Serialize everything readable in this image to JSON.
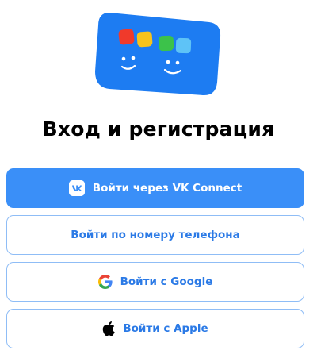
{
  "title": "Вход и регистрация",
  "buttons": {
    "vk": {
      "label": "Войти через VK Connect",
      "icon": "vk-icon"
    },
    "phone": {
      "label": "Войти по номеру телефона"
    },
    "google": {
      "label": "Войти с Google",
      "icon": "google-icon"
    },
    "apple": {
      "label": "Войти с Apple",
      "icon": "apple-icon"
    }
  },
  "colors": {
    "primary": "#3a8ff8",
    "outline_border": "#8fbdf6",
    "outline_text": "#2b7ae6",
    "logo_bg": "#1d7cf2"
  }
}
